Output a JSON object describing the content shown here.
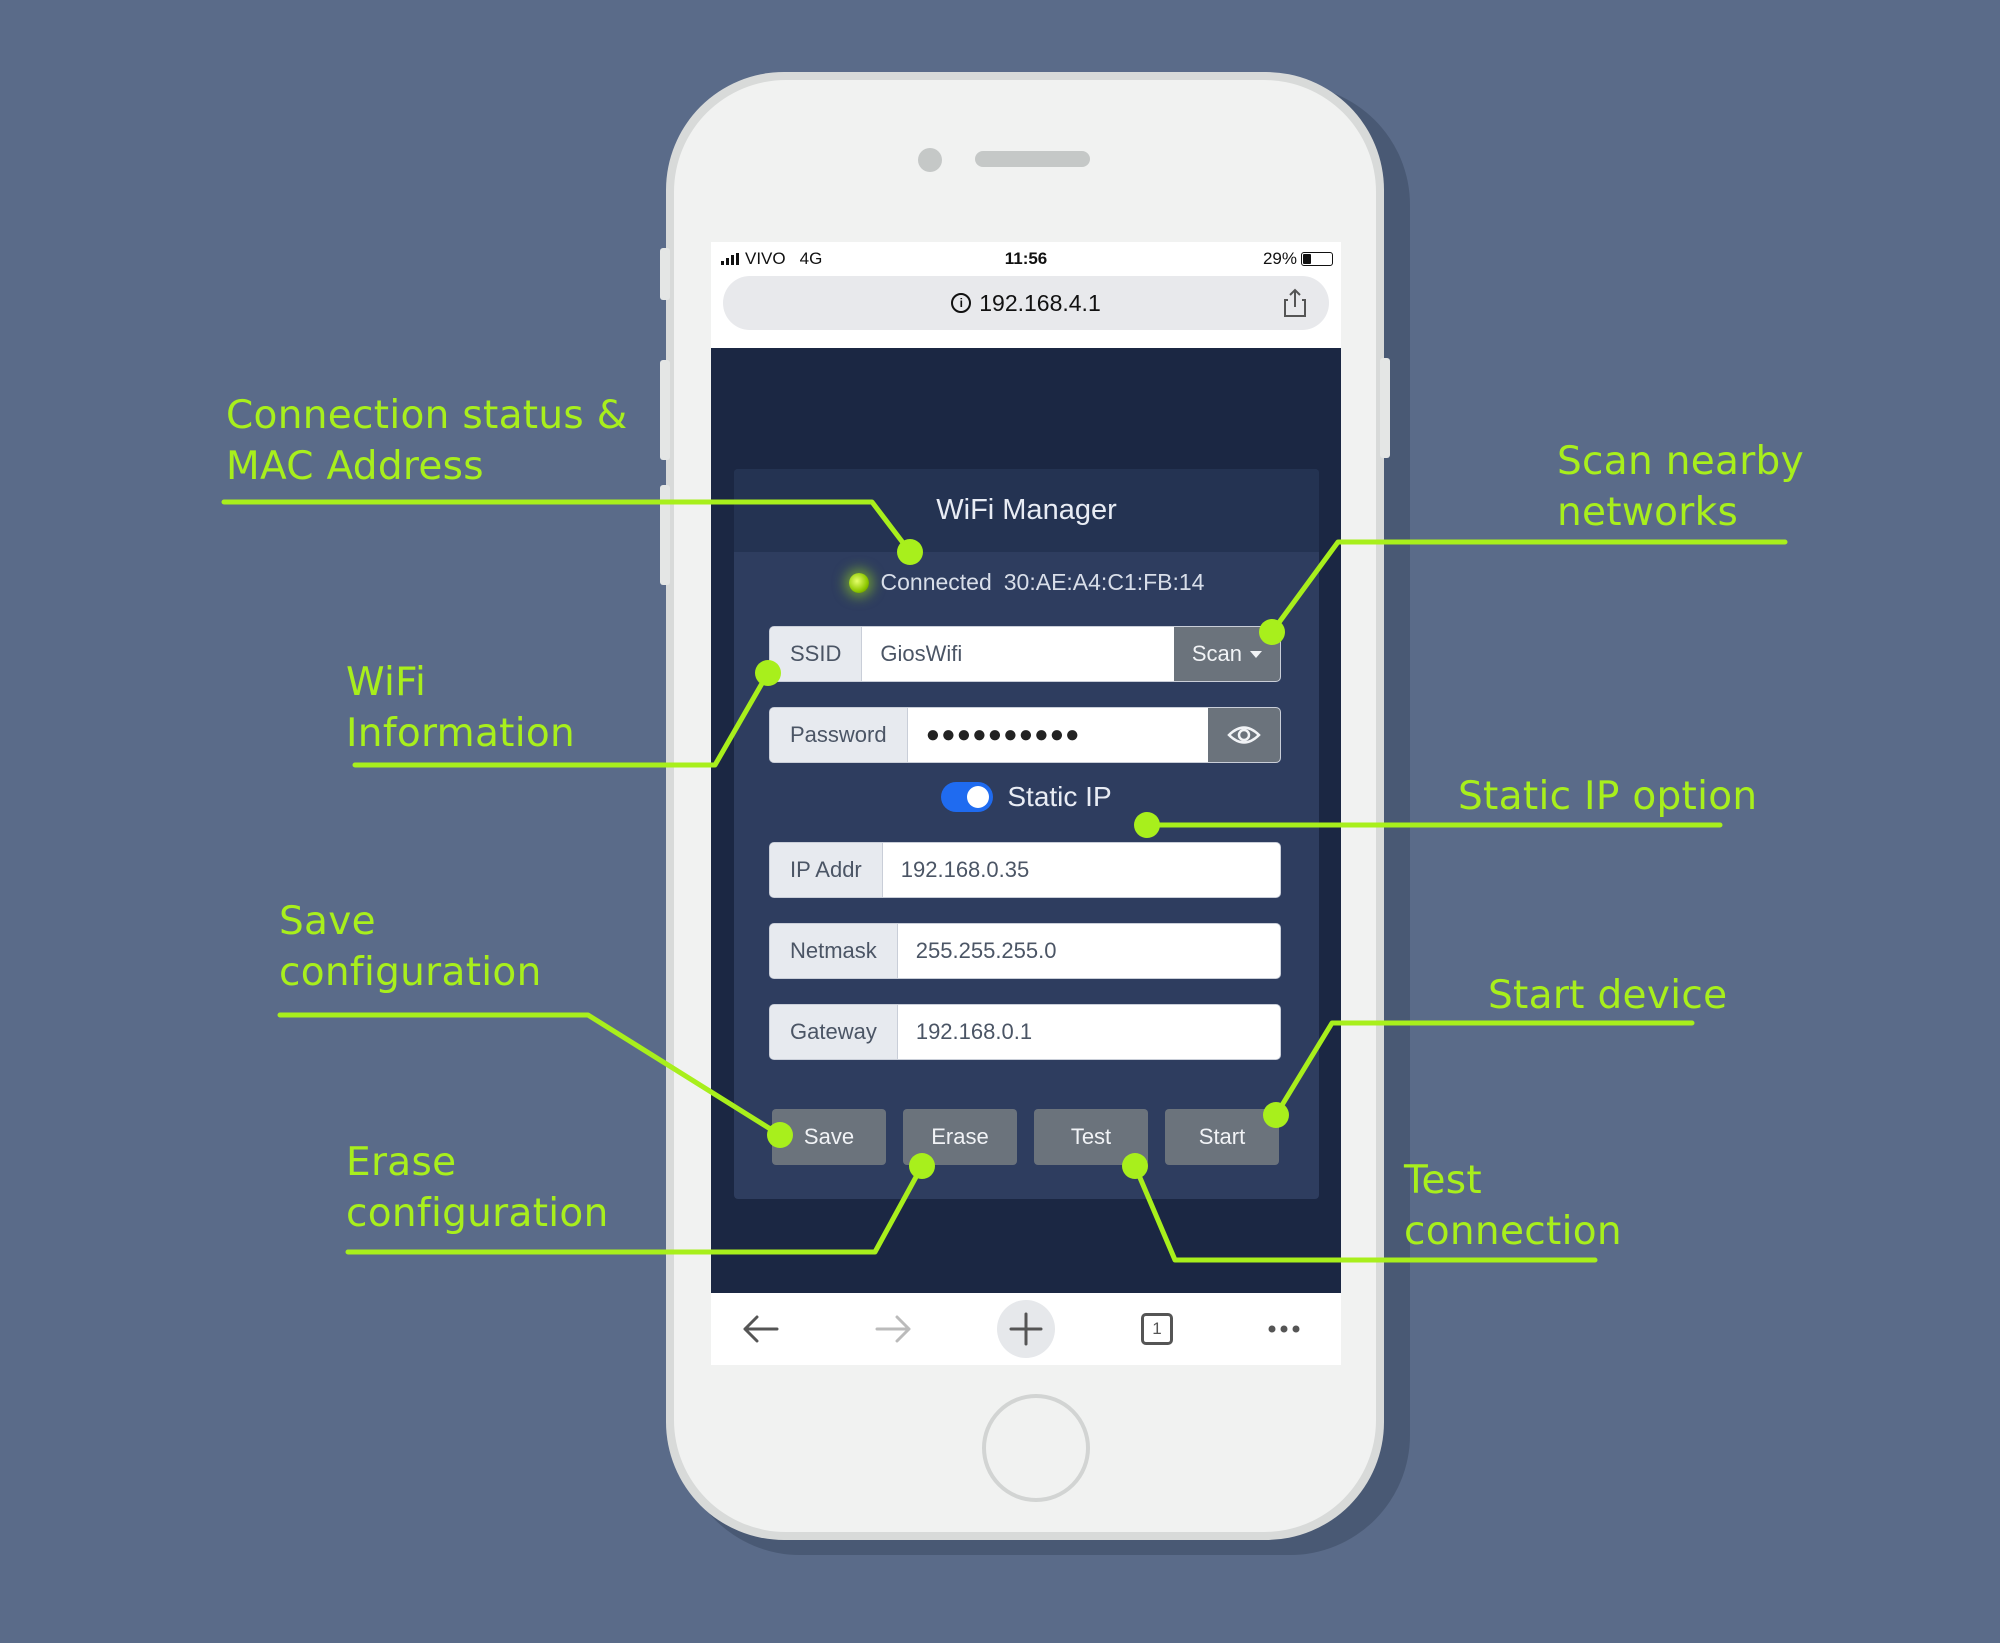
{
  "status_bar": {
    "carrier": "VIVO",
    "network": "4G",
    "time": "11:56",
    "battery": "29%"
  },
  "browser": {
    "url": "192.168.4.1",
    "tab_count": "1"
  },
  "wifi_manager": {
    "title": "WiFi Manager",
    "connection_status": "Connected",
    "mac_address": "30:AE:A4:C1:FB:14",
    "ssid": {
      "label": "SSID",
      "value": "GiosWifi",
      "scan_label": "Scan"
    },
    "password": {
      "label": "Password",
      "value": "●●●●●●●●●●"
    },
    "static_ip": {
      "label": "Static IP",
      "enabled": true
    },
    "ip_addr": {
      "label": "IP Addr",
      "value": "192.168.0.35"
    },
    "netmask": {
      "label": "Netmask",
      "value": "255.255.255.0"
    },
    "gateway": {
      "label": "Gateway",
      "value": "192.168.0.1"
    },
    "buttons": {
      "save": "Save",
      "erase": "Erase",
      "test": "Test",
      "start": "Start"
    }
  },
  "annotations": {
    "connection_status": [
      "Connection status &",
      "MAC Address"
    ],
    "scan": [
      "Scan nearby",
      "networks"
    ],
    "wifi_info": [
      "WiFi",
      "Information"
    ],
    "static_ip": [
      "Static IP option"
    ],
    "save": [
      "Save",
      "configuration"
    ],
    "start": [
      "Start device"
    ],
    "erase": [
      "Erase",
      "configuration"
    ],
    "test": [
      "Test",
      "connection"
    ]
  },
  "colors": {
    "annotation": "#a8ef1c",
    "background": "#5a6b89",
    "screen": "#1b2743",
    "toggle": "#1f6bf0"
  },
  "icons": [
    "info-icon",
    "share-icon",
    "eye-icon",
    "back-arrow-icon",
    "forward-arrow-icon",
    "plus-icon",
    "tabs-icon",
    "more-icon"
  ]
}
